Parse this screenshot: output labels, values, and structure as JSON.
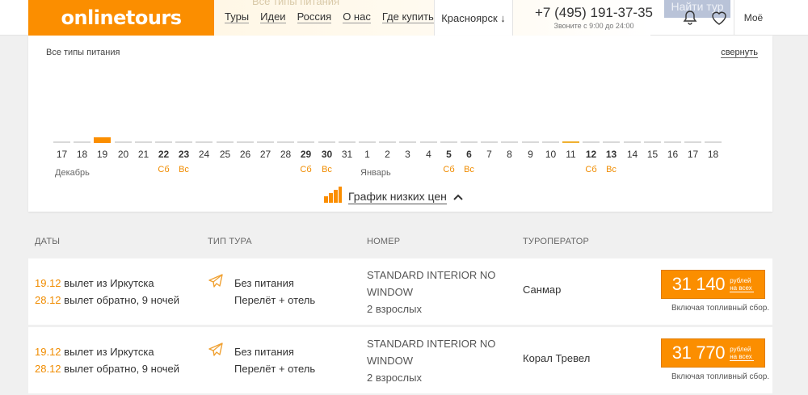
{
  "header": {
    "logo": "onlinetours",
    "ghost_search_text": "Все типы питания",
    "nav": [
      "Туры",
      "Идеи",
      "Россия",
      "О нас",
      "Где купить?"
    ],
    "city": "Красноярск ↓",
    "phone": "+7 (495) 191-37-35",
    "hours": "Звоните с 9:00 до 24:00",
    "ghost_button": "Найти тур",
    "bell_icon": "bell-icon",
    "heart_icon": "heart-icon",
    "my_label": "Моё"
  },
  "calendar": {
    "food_filter": "Все типы питания",
    "collapse_label": "свернуть",
    "days": [
      {
        "num": "17",
        "bold": false,
        "dow": "",
        "bar": "none"
      },
      {
        "num": "18",
        "bold": false,
        "dow": "",
        "bar": "none"
      },
      {
        "num": "19",
        "bold": false,
        "dow": "",
        "bar": "low"
      },
      {
        "num": "20",
        "bold": false,
        "dow": "",
        "bar": "none"
      },
      {
        "num": "21",
        "bold": false,
        "dow": "",
        "bar": "none"
      },
      {
        "num": "22",
        "bold": true,
        "dow": "Сб",
        "bar": "none"
      },
      {
        "num": "23",
        "bold": true,
        "dow": "Вс",
        "bar": "none"
      },
      {
        "num": "24",
        "bold": false,
        "dow": "",
        "bar": "none"
      },
      {
        "num": "25",
        "bold": false,
        "dow": "",
        "bar": "none"
      },
      {
        "num": "26",
        "bold": false,
        "dow": "",
        "bar": "none"
      },
      {
        "num": "27",
        "bold": false,
        "dow": "",
        "bar": "none"
      },
      {
        "num": "28",
        "bold": false,
        "dow": "",
        "bar": "none"
      },
      {
        "num": "29",
        "bold": true,
        "dow": "Сб",
        "bar": "none"
      },
      {
        "num": "30",
        "bold": true,
        "dow": "Вс",
        "bar": "none"
      },
      {
        "num": "31",
        "bold": false,
        "dow": "",
        "bar": "none"
      },
      {
        "num": "1",
        "bold": false,
        "dow": "",
        "bar": "none"
      },
      {
        "num": "2",
        "bold": false,
        "dow": "",
        "bar": "none"
      },
      {
        "num": "3",
        "bold": false,
        "dow": "",
        "bar": "none"
      },
      {
        "num": "4",
        "bold": false,
        "dow": "",
        "bar": "none"
      },
      {
        "num": "5",
        "bold": true,
        "dow": "Сб",
        "bar": "none"
      },
      {
        "num": "6",
        "bold": true,
        "dow": "Вс",
        "bar": "none"
      },
      {
        "num": "7",
        "bold": false,
        "dow": "",
        "bar": "none"
      },
      {
        "num": "8",
        "bold": false,
        "dow": "",
        "bar": "none"
      },
      {
        "num": "9",
        "bold": false,
        "dow": "",
        "bar": "none"
      },
      {
        "num": "10",
        "bold": false,
        "dow": "",
        "bar": "none"
      },
      {
        "num": "11",
        "bold": false,
        "dow": "",
        "bar": "mid"
      },
      {
        "num": "12",
        "bold": true,
        "dow": "Сб",
        "bar": "none"
      },
      {
        "num": "13",
        "bold": true,
        "dow": "Вс",
        "bar": "none"
      },
      {
        "num": "14",
        "bold": false,
        "dow": "",
        "bar": "none"
      },
      {
        "num": "15",
        "bold": false,
        "dow": "",
        "bar": "none"
      },
      {
        "num": "16",
        "bold": false,
        "dow": "",
        "bar": "none"
      },
      {
        "num": "17",
        "bold": false,
        "dow": "",
        "bar": "none"
      },
      {
        "num": "18",
        "bold": false,
        "dow": "",
        "bar": "none"
      }
    ],
    "months": [
      "Декабрь",
      "Январь"
    ],
    "chart_link": "График низких цен"
  },
  "table": {
    "headers": [
      "ДАТЫ",
      "ТИП ТУРА",
      "НОМЕР",
      "ТУРОПЕРАТОР"
    ],
    "rows": [
      {
        "out_date": "19.12",
        "out_text": " вылет из Иркутска",
        "back_date": "28.12",
        "back_text": " вылет обратно, 9 ночей",
        "meal": "Без питания",
        "package": "Перелёт + отель",
        "room": "STANDARD INTERIOR NO WINDOW",
        "guests": "2 взрослых",
        "operator": "Санмар",
        "price": "31 140",
        "currency": "рублей на всех",
        "fuel": "Включая топливный сбор."
      },
      {
        "out_date": "19.12",
        "out_text": " вылет из Иркутска",
        "back_date": "28.12",
        "back_text": " вылет обратно, 9 ночей",
        "meal": "Без питания",
        "package": "Перелёт + отель",
        "room": "STANDARD INTERIOR NO WINDOW",
        "guests": "2 взрослых",
        "operator": "Корал Тревел",
        "price": "31 770",
        "currency": "рублей на всех",
        "fuel": "Включая топливный сбор."
      }
    ]
  },
  "colors": {
    "accent": "#fb8e00",
    "weekend": "#f08c00"
  }
}
